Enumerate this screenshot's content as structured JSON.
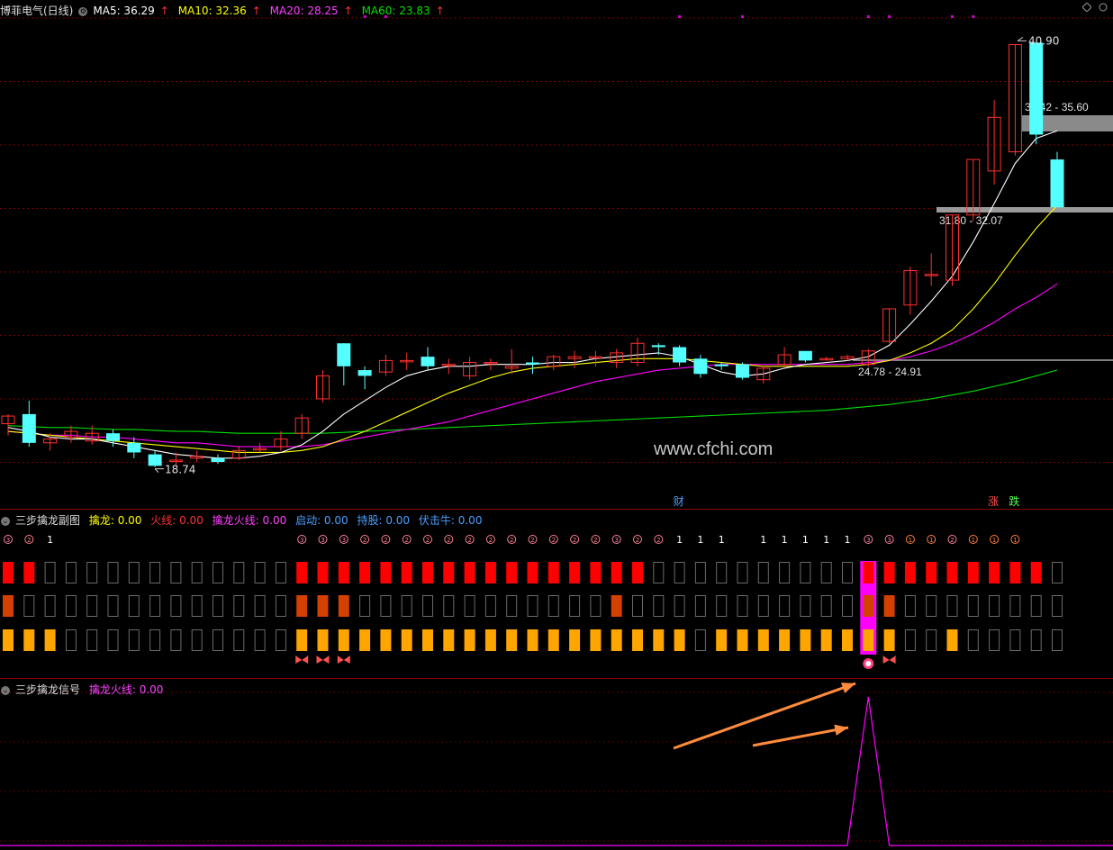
{
  "main_header": {
    "stock": "博菲电气(日线)",
    "ma5": "MA5: 36.29",
    "ma10": "MA10: 32.36",
    "ma20": "MA20: 28.25",
    "ma60": "MA60: 23.83",
    "arrow": "↑"
  },
  "price_labels": {
    "high": "40.90",
    "low": "18.74",
    "zone_top": "36.42 - 35.60",
    "zone_mid": "31.80 - 32.07",
    "zone_low": "24.78 - 24.91"
  },
  "markers": {
    "cai": "财",
    "zhang": "涨",
    "die": "跌"
  },
  "watermark": "www.cfchi.com",
  "sub_header": {
    "title": "三步擒龙副图",
    "qinlong": "擒龙: 0.00",
    "huoxian": "火线: 0.00",
    "qinlong_huoxian": "擒龙火线: 0.00",
    "qidong": "启动: 0.00",
    "chigu": "持股: 0.00",
    "fujiniu": "伏击牛: 0.00"
  },
  "sig_header": {
    "title": "三步擒龙信号",
    "qinlong_huoxian": "擒龙火线: 0.00"
  },
  "step_labels": [
    "③",
    "②",
    "1",
    "",
    "",
    "",
    "",
    "",
    "",
    "",
    "",
    "",
    "",
    "",
    "③",
    "③",
    "③",
    "②",
    "②",
    "②",
    "②",
    "②",
    "②",
    "②",
    "②",
    "②",
    "②",
    "②",
    "②",
    "③",
    "②",
    "②",
    "1",
    "1",
    "1",
    "",
    "1",
    "1",
    "1",
    "1",
    "1",
    "③",
    "③",
    "①",
    "①",
    "②",
    "①",
    "①",
    "①"
  ],
  "colors": {
    "up": "#ff3030",
    "down": "#54ffff",
    "ma5": "#ffffff",
    "ma10": "#ffff00",
    "ma20": "#ff00ff",
    "ma60": "#00e000",
    "row1": "#ff0000",
    "row2": "#d44000",
    "row3": "#ffa500",
    "highlight": "#ff00ff",
    "arrow": "#ff8c3c"
  },
  "chart_data": {
    "type": "candlestick",
    "y_range": [
      17.5,
      42
    ],
    "candles": [
      [
        21.0,
        21.4,
        20.4,
        21.5
      ],
      [
        21.5,
        20.0,
        19.8,
        22.2
      ],
      [
        20.0,
        20.2,
        19.6,
        20.5
      ],
      [
        20.3,
        20.6,
        20.0,
        20.9
      ],
      [
        20.1,
        20.5,
        19.9,
        20.9
      ],
      [
        20.5,
        20.1,
        19.8,
        20.7
      ],
      [
        20.0,
        19.5,
        19.2,
        20.3
      ],
      [
        19.4,
        18.8,
        18.74,
        19.6
      ],
      [
        19.1,
        19.1,
        18.8,
        19.5
      ],
      [
        19.2,
        19.3,
        19.0,
        19.6
      ],
      [
        19.2,
        19.0,
        18.9,
        19.4
      ],
      [
        19.2,
        19.6,
        19.1,
        19.8
      ],
      [
        19.7,
        19.7,
        19.5,
        20.0
      ],
      [
        19.8,
        20.2,
        19.6,
        20.6
      ],
      [
        20.5,
        21.3,
        20.2,
        21.5
      ],
      [
        22.3,
        23.5,
        22.1,
        23.8
      ],
      [
        25.2,
        24.0,
        23.0,
        25.2
      ],
      [
        23.8,
        23.5,
        22.8,
        24.0
      ],
      [
        23.7,
        24.3,
        23.5,
        24.6
      ],
      [
        24.3,
        24.3,
        23.8,
        24.7
      ],
      [
        24.5,
        24.0,
        23.8,
        25.0
      ],
      [
        24.1,
        24.1,
        23.6,
        24.4
      ],
      [
        23.5,
        24.2,
        23.3,
        24.5
      ],
      [
        24.2,
        24.2,
        23.8,
        24.4
      ],
      [
        23.9,
        24.0,
        23.6,
        24.9
      ],
      [
        24.2,
        24.1,
        23.6,
        24.5
      ],
      [
        24.0,
        24.5,
        23.8,
        24.6
      ],
      [
        24.4,
        24.5,
        23.9,
        24.8
      ],
      [
        24.5,
        24.5,
        24.0,
        24.8
      ],
      [
        24.2,
        24.7,
        23.9,
        24.9
      ],
      [
        24.2,
        25.2,
        24.0,
        25.5
      ],
      [
        25.1,
        25.0,
        24.6,
        25.2
      ],
      [
        25.0,
        24.2,
        24.0,
        25.1
      ],
      [
        24.4,
        23.6,
        23.4,
        24.6
      ],
      [
        24.1,
        24.0,
        23.8,
        24.2
      ],
      [
        24.1,
        23.4,
        23.3,
        24.2
      ],
      [
        23.3,
        23.9,
        23.1,
        24.0
      ],
      [
        24.1,
        24.6,
        24.0,
        25.0
      ],
      [
        24.8,
        24.3,
        24.2,
        24.8
      ],
      [
        24.4,
        24.4,
        24.3,
        24.5
      ],
      [
        24.4,
        24.5,
        24.3,
        24.6
      ],
      [
        24.1,
        24.8,
        24.0,
        24.9
      ],
      [
        25.3,
        27.0,
        25.2,
        27.0
      ],
      [
        27.2,
        29.0,
        26.7,
        29.2
      ],
      [
        28.8,
        28.8,
        28.2,
        29.9
      ],
      [
        28.5,
        31.9,
        28.2,
        31.9
      ],
      [
        31.9,
        34.8,
        31.6,
        34.8
      ],
      [
        34.2,
        37.0,
        33.5,
        37.9
      ],
      [
        35.2,
        40.8,
        35.0,
        40.8
      ],
      [
        40.9,
        36.1,
        35.6,
        40.9
      ],
      [
        34.8,
        32.3,
        32.3,
        35.2
      ]
    ],
    "ma5": [
      20.8,
      20.6,
      20.3,
      20.2,
      20.2,
      20.0,
      19.8,
      19.6,
      19.4,
      19.3,
      19.2,
      19.2,
      19.3,
      19.5,
      19.9,
      20.6,
      21.5,
      22.2,
      22.9,
      23.5,
      23.8,
      24.0,
      24.0,
      24.1,
      24.1,
      24.1,
      24.2,
      24.2,
      24.4,
      24.5,
      24.6,
      24.7,
      24.5,
      24.1,
      23.7,
      23.5,
      23.6,
      23.9,
      24.1,
      24.2,
      24.3,
      24.5,
      25.1,
      26.2,
      27.4,
      28.7,
      30.5,
      32.5,
      34.6,
      35.9,
      36.3
    ],
    "ma10": [
      20.6,
      20.5,
      20.4,
      20.3,
      20.2,
      20.1,
      20.0,
      19.9,
      19.8,
      19.7,
      19.6,
      19.5,
      19.5,
      19.5,
      19.6,
      19.8,
      20.2,
      20.6,
      21.1,
      21.6,
      22.1,
      22.6,
      23.0,
      23.4,
      23.7,
      23.9,
      24.0,
      24.1,
      24.2,
      24.3,
      24.4,
      24.4,
      24.4,
      24.3,
      24.2,
      24.1,
      24.0,
      24.0,
      24.0,
      24.0,
      24.0,
      24.1,
      24.3,
      24.7,
      25.2,
      25.9,
      27.0,
      28.3,
      29.8,
      31.2,
      32.4
    ],
    "ma20": [
      20.6,
      20.5,
      20.4,
      20.4,
      20.3,
      20.3,
      20.2,
      20.1,
      20.0,
      20.0,
      19.9,
      19.8,
      19.8,
      19.8,
      19.8,
      19.9,
      20.1,
      20.3,
      20.5,
      20.7,
      20.9,
      21.1,
      21.4,
      21.7,
      22.0,
      22.3,
      22.6,
      22.9,
      23.2,
      23.4,
      23.6,
      23.8,
      23.9,
      24.0,
      24.1,
      24.1,
      24.1,
      24.1,
      24.1,
      24.1,
      24.1,
      24.2,
      24.3,
      24.5,
      24.8,
      25.2,
      25.7,
      26.3,
      27.0,
      27.6,
      28.3
    ],
    "ma60": [
      20.9,
      20.85,
      20.8,
      20.8,
      20.75,
      20.7,
      20.7,
      20.65,
      20.6,
      20.6,
      20.55,
      20.5,
      20.5,
      20.5,
      20.5,
      20.5,
      20.55,
      20.6,
      20.65,
      20.7,
      20.75,
      20.8,
      20.85,
      20.9,
      20.95,
      21.0,
      21.05,
      21.1,
      21.15,
      21.2,
      21.25,
      21.3,
      21.35,
      21.4,
      21.45,
      21.5,
      21.55,
      21.6,
      21.65,
      21.7,
      21.8,
      21.9,
      22.0,
      22.15,
      22.3,
      22.5,
      22.7,
      22.95,
      23.2,
      23.5,
      23.8
    ],
    "row1": [
      1,
      1,
      0,
      0,
      0,
      0,
      0,
      0,
      0,
      0,
      0,
      0,
      0,
      0,
      1,
      1,
      1,
      1,
      1,
      1,
      1,
      1,
      1,
      1,
      1,
      1,
      1,
      1,
      1,
      1,
      1,
      0,
      0,
      0,
      0,
      0,
      0,
      0,
      0,
      0,
      0,
      1,
      1,
      1,
      1,
      1,
      1,
      1,
      1,
      1,
      0
    ],
    "row2": [
      1,
      0,
      0,
      0,
      0,
      0,
      0,
      0,
      0,
      0,
      0,
      0,
      0,
      0,
      1,
      1,
      1,
      0,
      0,
      0,
      0,
      0,
      0,
      0,
      0,
      0,
      0,
      0,
      0,
      1,
      0,
      0,
      0,
      0,
      0,
      0,
      0,
      0,
      0,
      0,
      0,
      1,
      1,
      0,
      0,
      0,
      0,
      0,
      0,
      0,
      0
    ],
    "row3": [
      1,
      1,
      1,
      0,
      0,
      0,
      0,
      0,
      0,
      0,
      0,
      0,
      0,
      0,
      1,
      1,
      1,
      1,
      1,
      1,
      1,
      1,
      1,
      1,
      1,
      1,
      1,
      1,
      1,
      1,
      1,
      1,
      1,
      0,
      1,
      1,
      1,
      1,
      1,
      1,
      1,
      1,
      1,
      0,
      0,
      1,
      0,
      0,
      0,
      0,
      0
    ],
    "highlight_index": 41,
    "signal_index": 41
  }
}
